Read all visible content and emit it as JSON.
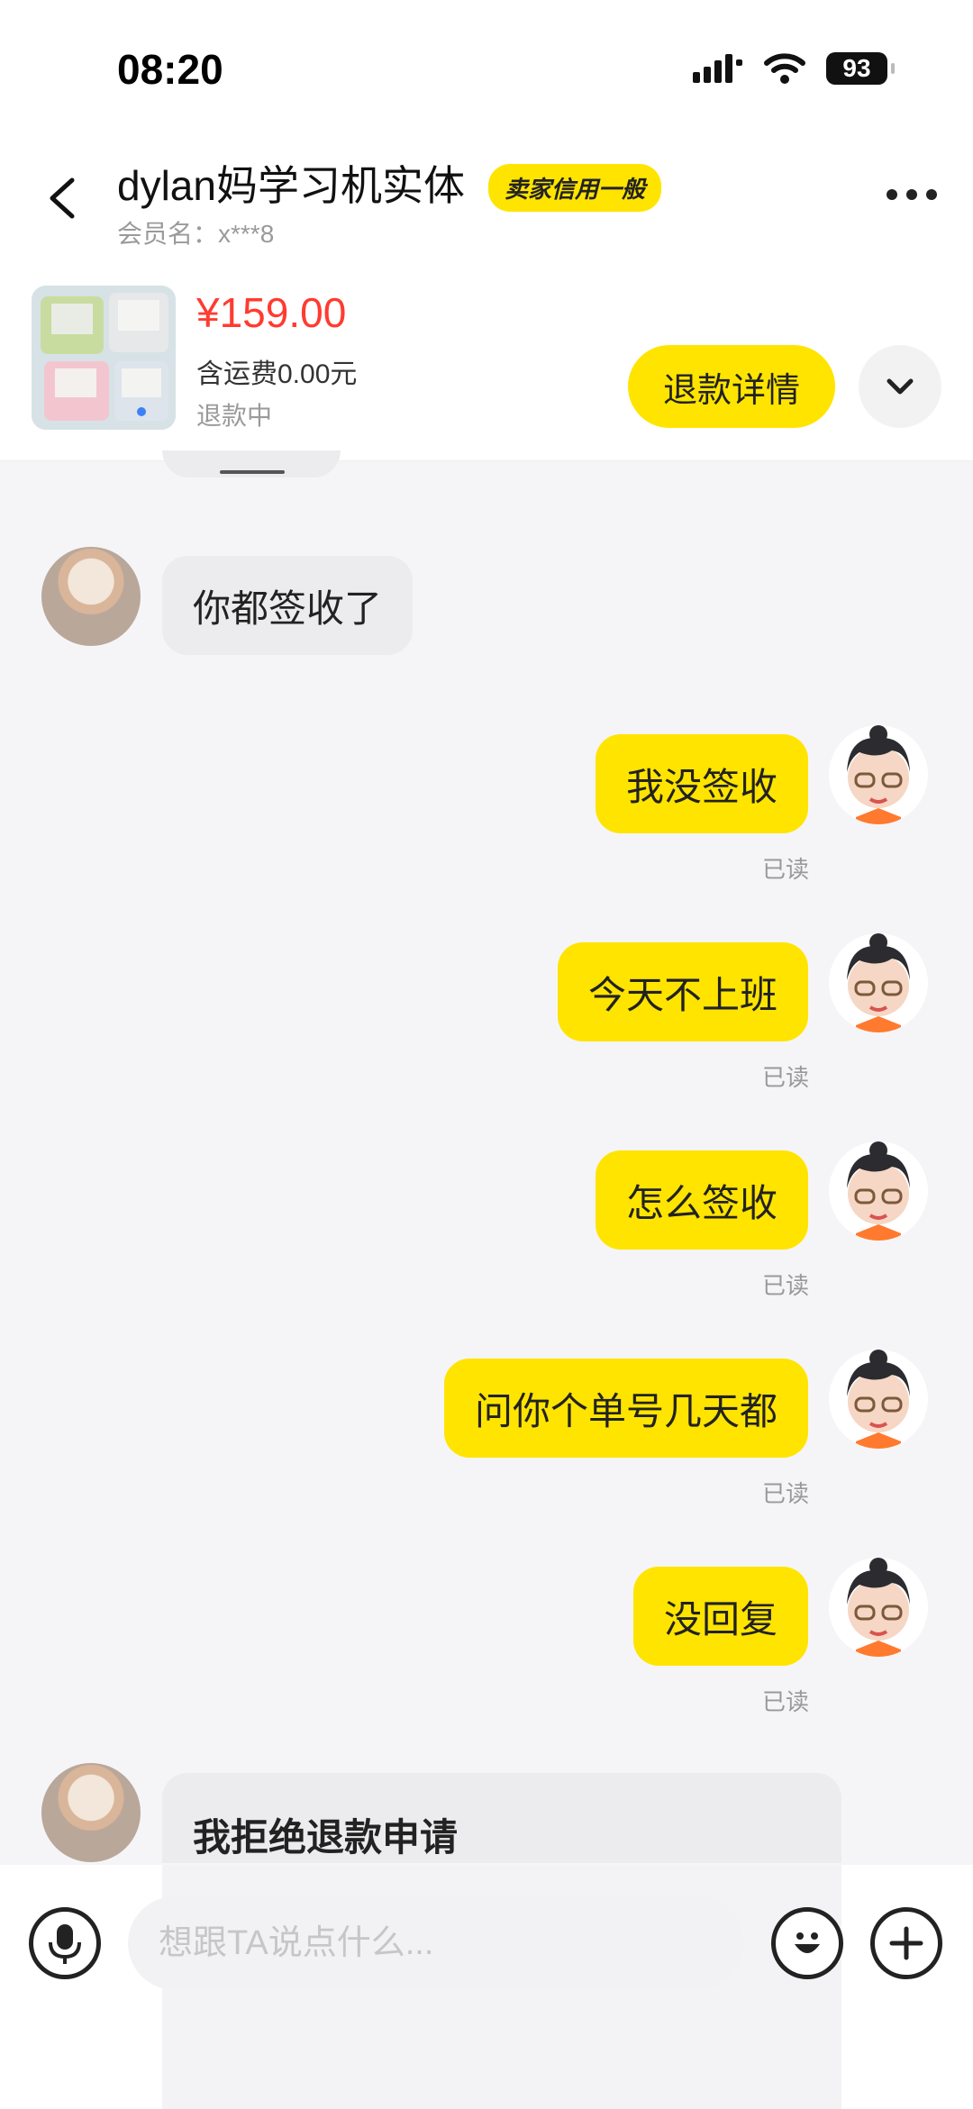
{
  "status_bar": {
    "time": "08:20",
    "battery": "93",
    "icons": [
      "signal-icon",
      "wifi-icon",
      "battery-icon"
    ]
  },
  "header": {
    "shop_name": "dylan妈学习机实体",
    "credit_badge": "卖家信用一般",
    "member_id": "会员名：x***8"
  },
  "order": {
    "price": "¥159.00",
    "shipping": "含运费0.00元",
    "status": "退款中",
    "refund_button": "退款详情"
  },
  "messages": [
    {
      "side": "other",
      "text": "你都签收了"
    },
    {
      "side": "self",
      "text": "我没签收",
      "read": "已读"
    },
    {
      "side": "self",
      "text": "今天不上班",
      "read": "已读"
    },
    {
      "side": "self",
      "text": "怎么签收",
      "read": "已读"
    },
    {
      "side": "self",
      "text": "问你个单号几天都",
      "read": "已读"
    },
    {
      "side": "self",
      "text": "没回复",
      "read": "已读"
    },
    {
      "side": "other",
      "text": "我拒绝退款申请"
    }
  ],
  "input": {
    "placeholder": "想跟TA说点什么..."
  },
  "colors": {
    "accent_yellow": "#ffe400",
    "price_red": "#ff3b30",
    "other_bubble": "#ececee",
    "muted_text": "#999999"
  }
}
